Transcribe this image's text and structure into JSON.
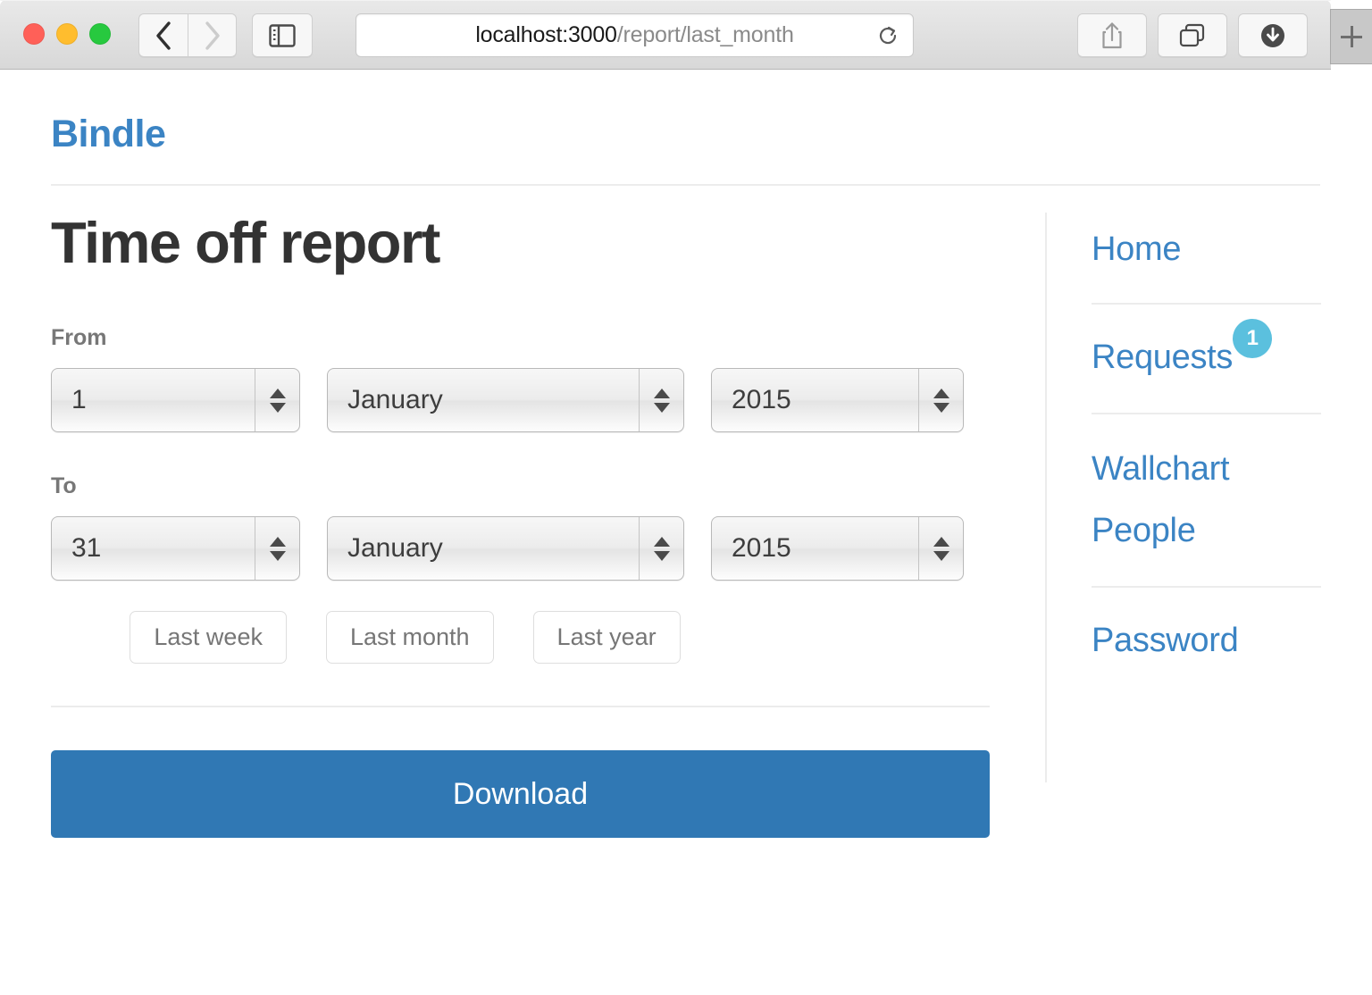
{
  "browser": {
    "window_controls": [
      {
        "name": "close",
        "color": "#ff6058"
      },
      {
        "name": "minimize",
        "color": "#ffbd2e"
      },
      {
        "name": "zoom",
        "color": "#27c93f"
      }
    ],
    "back_label": "Back",
    "forward_label": "Forward",
    "sidebar_toggle_label": "Show sidebar",
    "url_host": "localhost:3000",
    "url_path": "/report/last_month",
    "reload_label": "Reload",
    "share_label": "Share",
    "tabs_label": "Show tab overview",
    "downloads_label": "Downloads",
    "newtab_label": "+"
  },
  "header": {
    "brand": "Bindle"
  },
  "main": {
    "title": "Time off report",
    "from_label": "From",
    "to_label": "To",
    "from": {
      "day": "1",
      "month": "January",
      "year": "2015"
    },
    "to": {
      "day": "31",
      "month": "January",
      "year": "2015"
    },
    "quick_ranges": [
      {
        "label": "Last week"
      },
      {
        "label": "Last month"
      },
      {
        "label": "Last year"
      }
    ],
    "download_label": "Download"
  },
  "sidebar": {
    "items": [
      {
        "label": "Home"
      },
      {
        "label": "Requests",
        "badge": "1"
      },
      {
        "label": "Wallchart"
      },
      {
        "label": "People"
      },
      {
        "label": "Password"
      }
    ]
  },
  "colors": {
    "link_blue": "#3b84c4",
    "button_blue": "#3078b4",
    "badge_blue": "#5bc0de",
    "title_gray": "#333333",
    "label_gray": "#777777",
    "rule_gray": "#ececec"
  }
}
